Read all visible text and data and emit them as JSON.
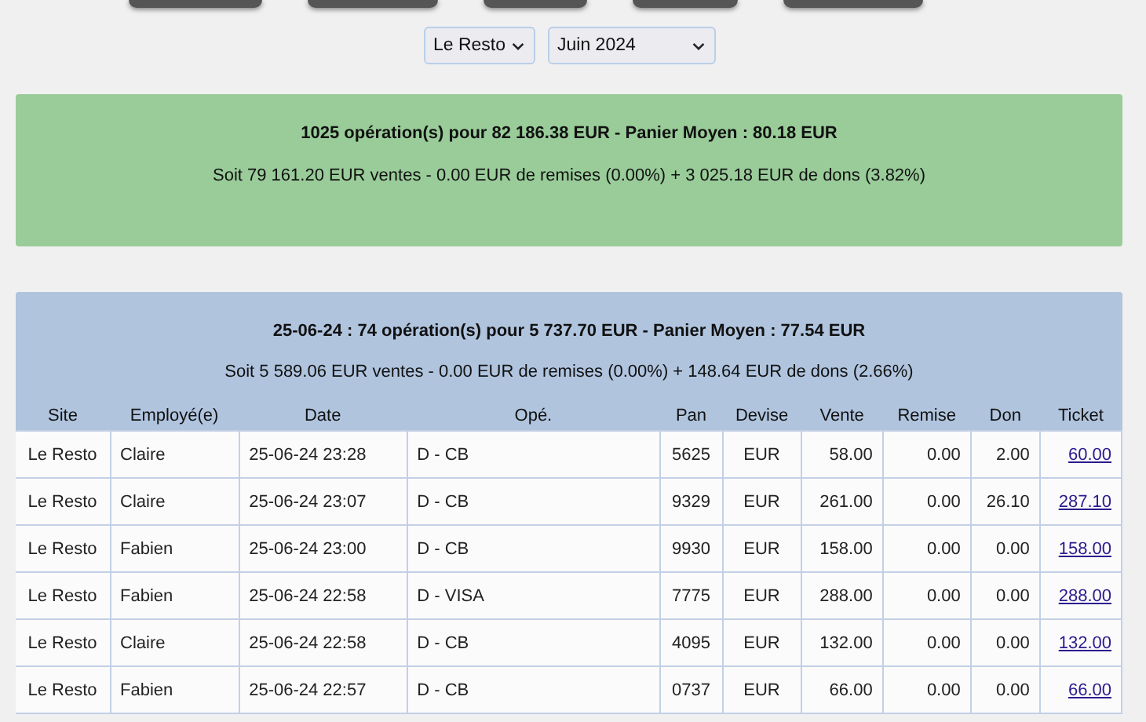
{
  "filters": [
    {
      "value": "Le Resto"
    },
    {
      "value": "Juin 2024"
    }
  ],
  "summary": {
    "title": "1025 opération(s) pour 82 186.38 EUR - Panier Moyen : 80.18 EUR",
    "detail": "Soit 79 161.20 EUR ventes - 0.00 EUR de remises (0.00%) + 3 025.18 EUR de dons (3.82%)"
  },
  "day": {
    "title": "25-06-24 : 74 opération(s) pour 5 737.70 EUR - Panier Moyen : 77.54 EUR",
    "detail": "Soit 5 589.06 EUR ventes - 0.00 EUR de remises (0.00%) + 148.64 EUR de dons (2.66%)",
    "table": {
      "columns": [
        "Site",
        "Employé(e)",
        "Date",
        "Opé.",
        "Pan",
        "Devise",
        "Vente",
        "Remise",
        "Don",
        "Ticket"
      ],
      "rows": [
        [
          "Le Resto",
          "Claire",
          "25-06-24 23:28",
          "D - CB",
          "5625",
          "EUR",
          "58.00",
          "0.00",
          "2.00",
          "60.00"
        ],
        [
          "Le Resto",
          "Claire",
          "25-06-24 23:07",
          "D - CB",
          "9329",
          "EUR",
          "261.00",
          "0.00",
          "26.10",
          "287.10"
        ],
        [
          "Le Resto",
          "Fabien",
          "25-06-24 23:00",
          "D - CB",
          "9930",
          "EUR",
          "158.00",
          "0.00",
          "0.00",
          "158.00"
        ],
        [
          "Le Resto",
          "Fabien",
          "25-06-24 22:58",
          "D - VISA",
          "7775",
          "EUR",
          "288.00",
          "0.00",
          "0.00",
          "288.00"
        ],
        [
          "Le Resto",
          "Claire",
          "25-06-24 22:58",
          "D - CB",
          "4095",
          "EUR",
          "132.00",
          "0.00",
          "0.00",
          "132.00"
        ],
        [
          "Le Resto",
          "Fabien",
          "25-06-24 22:57",
          "D - CB",
          "0737",
          "EUR",
          "66.00",
          "0.00",
          "0.00",
          "66.00"
        ]
      ]
    }
  }
}
